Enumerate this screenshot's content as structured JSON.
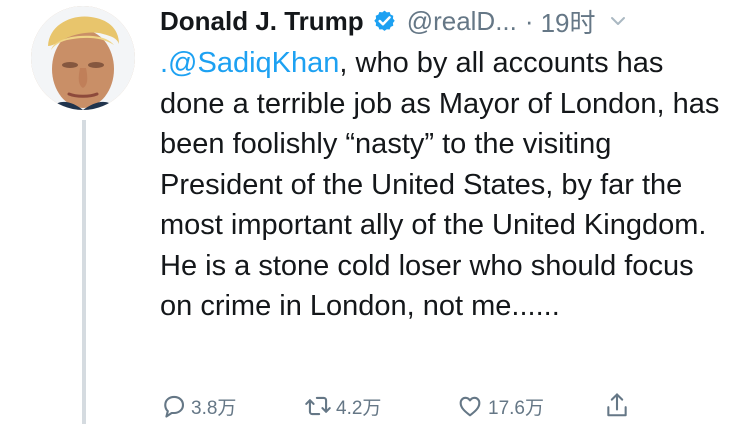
{
  "tweet": {
    "author_name": "Donald J. Trump",
    "handle": "@realD...",
    "separator": "·",
    "timestamp": "19时",
    "mention": ".@SadiqKhan",
    "text_after_mention": ", who by all accounts has done a terrible job as Mayor of London, has been foolishly “nasty” to the visiting President of the United States, by far the most important ally of the United Kingdom. He is a stone cold loser who should focus on crime in London, not me......",
    "actions": {
      "reply_count": "3.8万",
      "retweet_count": "4.2万",
      "like_count": "17.6万"
    }
  },
  "icons": {
    "verified": "verified-badge-icon",
    "caret": "chevron-down-icon",
    "reply": "reply-icon",
    "retweet": "retweet-icon",
    "like": "heart-icon",
    "share": "share-icon"
  },
  "colors": {
    "mention": "#1da1f2",
    "verified": "#1da1f2",
    "secondary_text": "#657786",
    "thread_line": "#d5dbe0"
  }
}
